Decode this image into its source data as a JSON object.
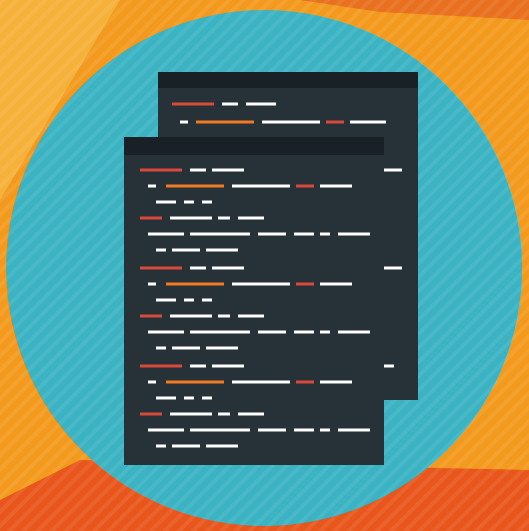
{
  "illustration": {
    "subject": "code-files-icon",
    "colors": {
      "background_orange": "#F39A1E",
      "background_dark_orange": "#E8561C",
      "background_orange_light": "#F6B13A",
      "circle_teal": "#3BB3C3",
      "circle_teal_dark": "#2F9FAE",
      "document_body": "#263238",
      "document_header": "#1A2126",
      "code_white": "#FFFFFF",
      "code_red": "#D94A3C",
      "code_orange": "#F07B23"
    }
  }
}
